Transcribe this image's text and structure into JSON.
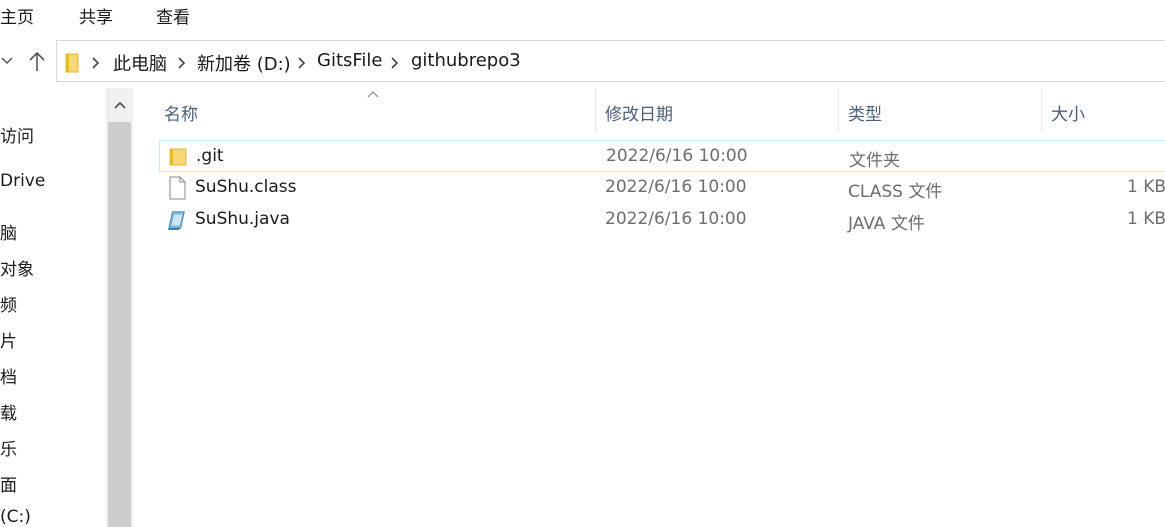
{
  "ribbon": {
    "tabs": [
      {
        "label": "主页"
      },
      {
        "label": "共享"
      },
      {
        "label": "查看"
      }
    ]
  },
  "address": {
    "crumbs": [
      "此电脑",
      "新加卷 (D:)",
      "GitsFile",
      "githubrepo3"
    ]
  },
  "nav_pane": {
    "items": [
      "访问",
      "Drive",
      "脑",
      " 对象",
      "频",
      "片",
      "档",
      "载",
      "乐",
      "面",
      " (C:)"
    ]
  },
  "columns": {
    "name": "名称",
    "modified": "修改日期",
    "type": "类型",
    "size": "大小"
  },
  "files": [
    {
      "name": ".git",
      "modified": "2022/6/16 10:00",
      "type": "文件夹",
      "size": "",
      "icon": "folder-icon",
      "selected": true
    },
    {
      "name": "SuShu.class",
      "modified": "2022/6/16 10:00",
      "type": "CLASS 文件",
      "size": "1 KB",
      "icon": "file-icon",
      "selected": false
    },
    {
      "name": "SuShu.java",
      "modified": "2022/6/16 10:00",
      "type": "JAVA 文件",
      "size": "1 KB",
      "icon": "java-file-icon",
      "selected": false
    }
  ],
  "colors": {
    "selection_border": "#cce8ff",
    "header_text": "#4c607a",
    "folder_yellow": "#f8d775"
  }
}
